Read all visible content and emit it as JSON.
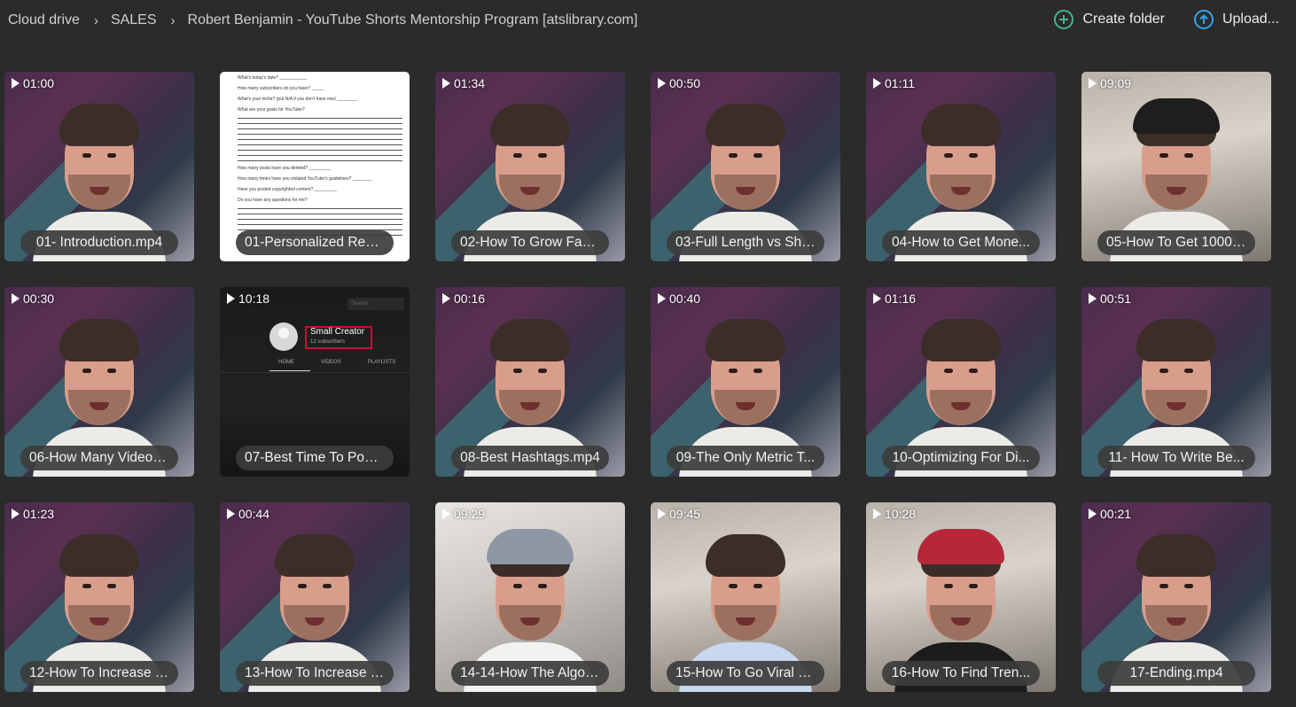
{
  "breadcrumb": {
    "items": [
      "Cloud drive",
      "SALES",
      "Robert Benjamin - YouTube Shorts Mentorship Program [atslibrary.com]"
    ]
  },
  "actions": {
    "create_folder": "Create folder",
    "upload": "Upload..."
  },
  "colors": {
    "background": "#2b2b2b",
    "create_accent": "#3fb68c",
    "upload_accent": "#33a6e8"
  },
  "document_preview": {
    "lines": [
      "What's today's date? ___________",
      "How many subscribers do you have? _____",
      "What's your niche? (put N/A if you don't have one) ________",
      "What are your goals for YouTube?",
      "How many posts have you deleted? _________",
      "How many times have you violated YouTube's guidelines? ________",
      "Have you posted copyrighted content? _________",
      "Do you have any questions for me?"
    ]
  },
  "channel_preview": {
    "search": "Search",
    "channel_name": "Small Creator",
    "subscribers": "12 subscribers",
    "tabs": [
      "HOME",
      "VIDEOS",
      "PLAYLISTS"
    ]
  },
  "files": [
    {
      "name": "01- Introduction.mp4",
      "duration": "01:00",
      "type": "video",
      "style": "default"
    },
    {
      "name": "01-Personalized Reco...",
      "duration": "",
      "type": "doc",
      "style": "doc"
    },
    {
      "name": "02-How To Grow Fast...",
      "duration": "01:34",
      "type": "video",
      "style": "default"
    },
    {
      "name": "03-Full Length vs Sho...",
      "duration": "00:50",
      "type": "video",
      "style": "default"
    },
    {
      "name": "04-How to Get Mone...",
      "duration": "01:11",
      "type": "video",
      "style": "default"
    },
    {
      "name": "05-How To Get 1000 ...",
      "duration": "09:09",
      "type": "video",
      "style": "room-cap"
    },
    {
      "name": "06-How Many Videos...",
      "duration": "00:30",
      "type": "video",
      "style": "default"
    },
    {
      "name": "07-Best Time To Post....",
      "duration": "10:18",
      "type": "video",
      "style": "channel"
    },
    {
      "name": "08-Best Hashtags.mp4",
      "duration": "00:16",
      "type": "video",
      "style": "default"
    },
    {
      "name": "09-The Only Metric T...",
      "duration": "00:40",
      "type": "video",
      "style": "default"
    },
    {
      "name": "10-Optimizing For Di...",
      "duration": "01:16",
      "type": "video",
      "style": "default"
    },
    {
      "name": "11- How To Write Be...",
      "duration": "00:51",
      "type": "video",
      "style": "default"
    },
    {
      "name": "12-How To Increase Y...",
      "duration": "01:23",
      "type": "video",
      "style": "default"
    },
    {
      "name": "13-How To Increase Y...",
      "duration": "00:44",
      "type": "video",
      "style": "default"
    },
    {
      "name": "14-14-How The Algor...",
      "duration": "09:29",
      "type": "video",
      "style": "gray-cap"
    },
    {
      "name": "15-How To Go Viral o...",
      "duration": "09:45",
      "type": "video",
      "style": "room-blue"
    },
    {
      "name": "16-How To Find Tren...",
      "duration": "10:28",
      "type": "video",
      "style": "red-cap"
    },
    {
      "name": "17-Ending.mp4",
      "duration": "00:21",
      "type": "video",
      "style": "default"
    }
  ]
}
